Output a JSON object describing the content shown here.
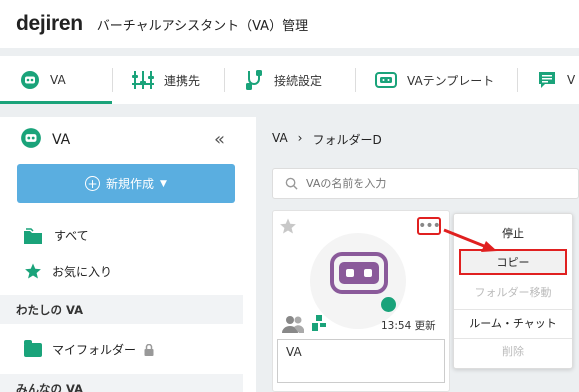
{
  "header": {
    "logo": "dejiren",
    "app_title": "バーチャルアシスタント（VA）管理"
  },
  "tabs": [
    {
      "label": "VA",
      "icon": "va-robot-icon",
      "active": true
    },
    {
      "label": "連携先",
      "icon": "integrations-icon",
      "active": false
    },
    {
      "label": "接続設定",
      "icon": "connection-icon",
      "active": false
    },
    {
      "label": "VAテンプレート",
      "icon": "template-icon",
      "active": false
    },
    {
      "label": "V",
      "icon": "chat-list-icon",
      "active": false
    }
  ],
  "sidebar": {
    "title": "VA",
    "collapse_icon": "double-chevron-left-icon",
    "new_button": "新規作成",
    "items": [
      {
        "label": "すべて",
        "icon": "folders-icon"
      },
      {
        "label": "お気に入り",
        "icon": "star-icon"
      }
    ],
    "section_my": "わたしの VA",
    "my_folder": "マイフォルダー",
    "section_all": "みんなの VA"
  },
  "main": {
    "breadcrumb_root": "VA",
    "breadcrumb_sep": "›",
    "breadcrumb_folder": "フォルダーD",
    "search_placeholder": "VAの名前を入力",
    "card": {
      "time": "13:54 更新",
      "name": "VA"
    }
  },
  "menu": {
    "items": [
      {
        "label": "停止",
        "disabled": false
      },
      {
        "label": "コピー",
        "disabled": false,
        "highlight": true
      },
      {
        "label": "フォルダー移動",
        "disabled": true
      },
      {
        "label": "ルーム・チャット",
        "disabled": false
      },
      {
        "label": "削除",
        "disabled": true
      }
    ]
  },
  "colors": {
    "brand_green": "#1aa37a",
    "button_blue": "#5aaee0",
    "va_purple": "#8a5a9a",
    "annotation_red": "#e02020"
  }
}
